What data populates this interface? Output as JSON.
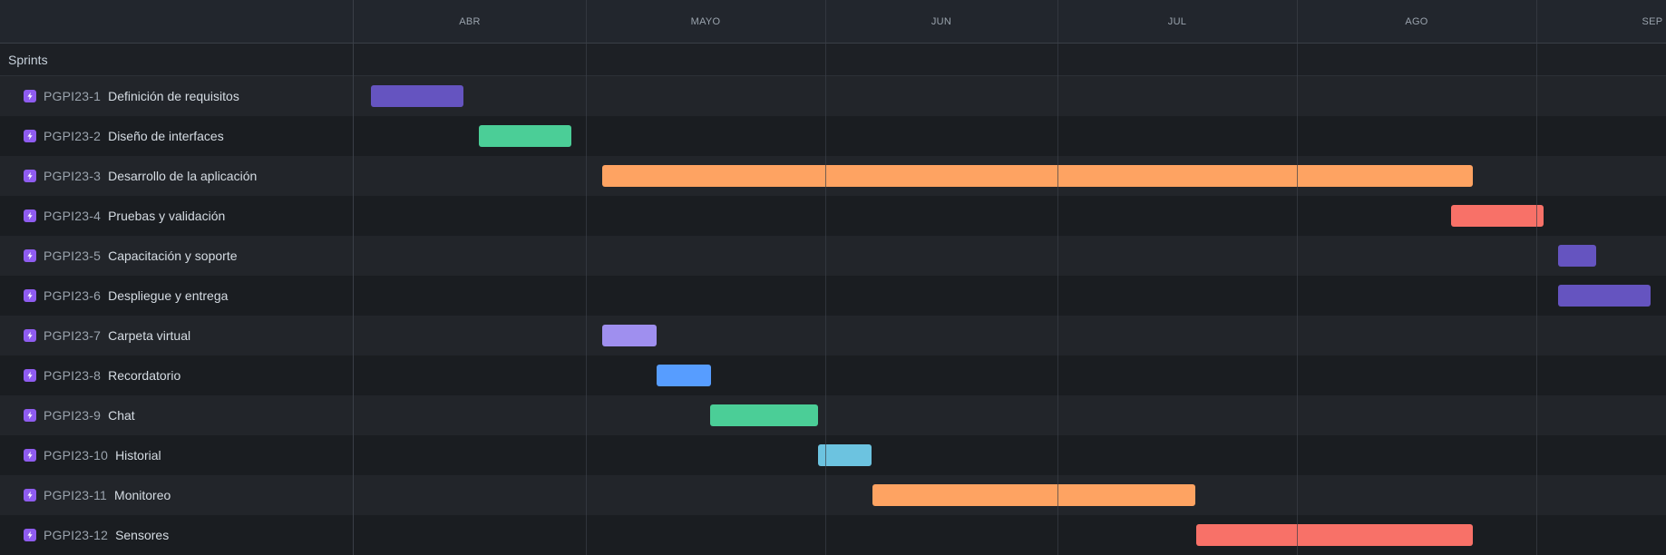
{
  "timeline": {
    "months": [
      "ABR",
      "MAYO",
      "JUN",
      "JUL",
      "AGO",
      "SEP"
    ],
    "section_label": "Sprints"
  },
  "tasks": [
    {
      "key": "PGPI23-1",
      "title": "Definición de requisitos",
      "color": "#6554c0"
    },
    {
      "key": "PGPI23-2",
      "title": "Diseño de interfaces",
      "color": "#4bce97"
    },
    {
      "key": "PGPI23-3",
      "title": "Desarrollo de la aplicación",
      "color": "#fea362"
    },
    {
      "key": "PGPI23-4",
      "title": "Pruebas y validación",
      "color": "#f87168"
    },
    {
      "key": "PGPI23-5",
      "title": "Capacitación y soporte",
      "color": "#6554c0"
    },
    {
      "key": "PGPI23-6",
      "title": "Despliegue y entrega",
      "color": "#6554c0"
    },
    {
      "key": "PGPI23-7",
      "title": "Carpeta virtual",
      "color": "#9f8fef"
    },
    {
      "key": "PGPI23-8",
      "title": "Recordatorio",
      "color": "#579dff"
    },
    {
      "key": "PGPI23-9",
      "title": "Chat",
      "color": "#4bce97"
    },
    {
      "key": "PGPI23-10",
      "title": "Historial",
      "color": "#6cc3e0"
    },
    {
      "key": "PGPI23-11",
      "title": "Monitoreo",
      "color": "#fea362"
    },
    {
      "key": "PGPI23-12",
      "title": "Sensores",
      "color": "#f87168"
    }
  ],
  "icons": {
    "task_icon": "lightning-icon",
    "task_icon_color": "#8f5cf0"
  }
}
